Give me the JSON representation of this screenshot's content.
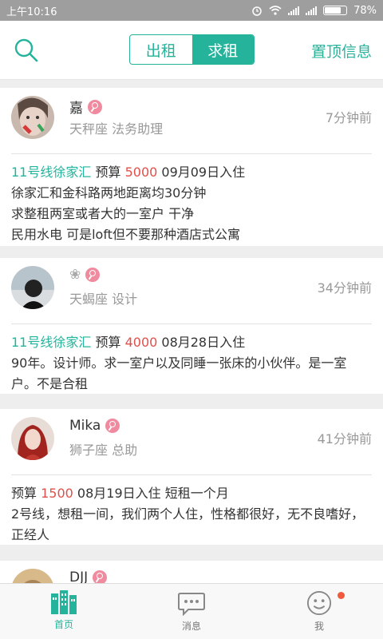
{
  "status_bar": {
    "time": "上午10:16",
    "battery": "78%"
  },
  "top_nav": {
    "segments": [
      "出租",
      "求租"
    ],
    "active_segment": 1,
    "pin_label": "置顶信息"
  },
  "posts": [
    {
      "name": "嘉",
      "meta": "天秤座  法务助理",
      "time": "7分钟前",
      "location": "11号线徐家汇",
      "budget_label": "预算",
      "budget": "5000",
      "movein": "09月09日入住",
      "extra": "",
      "desc": "徐家汇和金科路两地距离均30分钟\n求整租两室或者大的一室户 干净\n民用水电 可是loft但不要那种酒店式公寓"
    },
    {
      "name": "❀",
      "meta": "天蝎座  设计",
      "time": "34分钟前",
      "location": "11号线徐家汇",
      "budget_label": "预算",
      "budget": "4000",
      "movein": "08月28日入住",
      "extra": "",
      "desc": "90年。设计师。求一室户以及同睡一张床的小伙伴。是一室户。不是合租"
    },
    {
      "name": "Mika",
      "meta": "狮子座  总助",
      "time": "41分钟前",
      "location": "",
      "budget_label": "预算",
      "budget": "1500",
      "movein": "08月19日入住",
      "extra": "短租一个月",
      "desc": "2号线，想租一间，我们两个人住，性格都很好，无不良嗜好，正经人"
    },
    {
      "name": "DJJ",
      "meta": "",
      "time": "",
      "location": "",
      "budget_label": "",
      "budget": "",
      "movein": "",
      "extra": "",
      "desc": ""
    }
  ],
  "tab_bar": {
    "tabs": [
      {
        "label": "首页",
        "icon": "building-icon"
      },
      {
        "label": "消息",
        "icon": "chat-bubble-icon"
      },
      {
        "label": "我",
        "icon": "smiley-icon"
      }
    ],
    "active_tab": 0
  },
  "colors": {
    "accent": "#26b39b",
    "price": "#e0504a",
    "badge": "#f08a9e",
    "notification": "#f05a3c"
  }
}
